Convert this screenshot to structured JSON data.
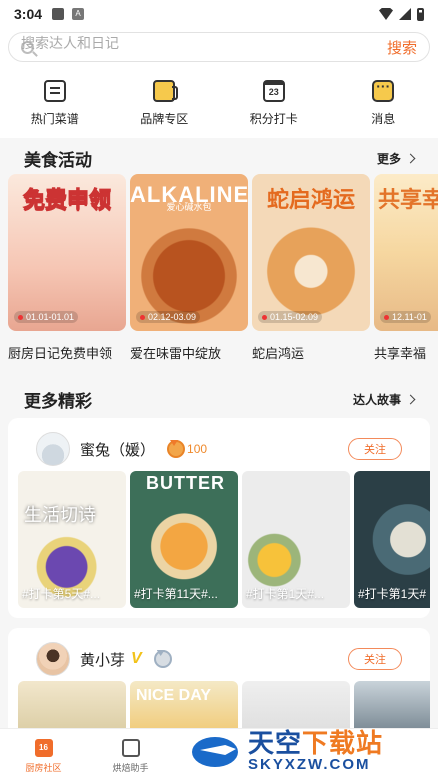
{
  "status": {
    "time": "3:04"
  },
  "search": {
    "placeholder": "搜索达人和日记",
    "action": "搜索"
  },
  "quick": [
    "热门菜谱",
    "品牌专区",
    "积分打卡",
    "消息"
  ],
  "quick_cal_day": "23",
  "activity_section": {
    "title": "美食活动",
    "more": "更多"
  },
  "activities": [
    {
      "image_text": "免费申领",
      "image_sub": "",
      "date": "01.01-01.01",
      "caption": "厨房日记免费申领"
    },
    {
      "image_text": "ALKALINE",
      "image_sub": "爱心碱水包",
      "date": "02.12-03.09",
      "caption": "爱在味雷中绽放"
    },
    {
      "image_text": "蛇启鸿运",
      "image_sub": "",
      "date": "01.15-02.09",
      "caption": "蛇启鸿运"
    },
    {
      "image_text": "共享幸焙感",
      "image_sub": "",
      "date": "12.11-01",
      "caption": "共享幸福"
    }
  ],
  "more_section": {
    "title": "更多精彩",
    "more": "达人故事"
  },
  "posts": [
    {
      "user": "蜜兔（媛）",
      "score": "100",
      "follow": "关注",
      "photos": [
        {
          "label": "生活切诗",
          "tag": "#打卡第5天#..."
        },
        {
          "label": "BUTTER",
          "tag": "#打卡第11天#..."
        },
        {
          "label": "",
          "tag": "#打卡第1天#..."
        },
        {
          "label": "",
          "tag": "#打卡第1天#"
        }
      ]
    },
    {
      "user": "黄小芽",
      "follow": "关注",
      "photos": [
        {
          "label": ""
        },
        {
          "label": "NICE DAY"
        },
        {
          "label": ""
        },
        {
          "label": ""
        }
      ]
    }
  ],
  "tabs": [
    {
      "label": "厨房社区",
      "icon": "16"
    },
    {
      "label": "烘焙助手",
      "icon": ""
    }
  ],
  "watermark": {
    "cn_a": "天空",
    "cn_b": "下载站",
    "en": "SKYXZW.COM"
  },
  "colors": {
    "accent": "#f06d2b",
    "vip": "#f2c21a",
    "score": "#ef8a2d"
  }
}
